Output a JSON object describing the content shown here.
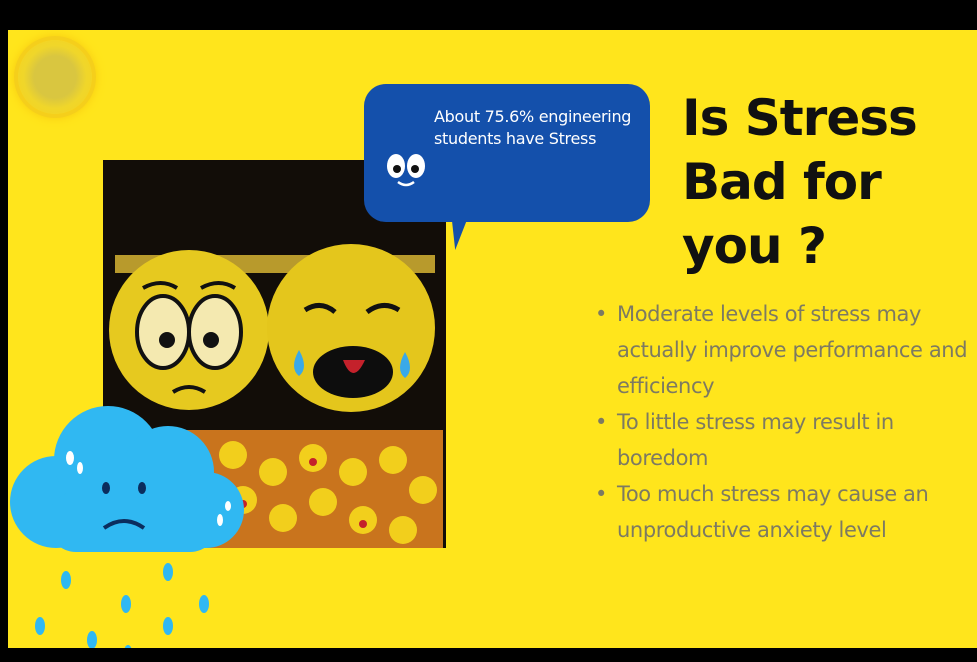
{
  "slide": {
    "bubble_text": "About 75.6% engineering students have Stress",
    "title": "Is Stress Bad for you ?",
    "bullets": [
      "Moderate levels of stress may actually improve performance and efficiency",
      "To little stress may result in boredom",
      "Too much stress may cause an unproductive anxiety level"
    ]
  },
  "colors": {
    "background": "#FFE51C",
    "bubble": "#1450AB",
    "title": "#111111",
    "bullet_text": "#7D7A62",
    "cloud": "#30B8F2"
  },
  "icons": [
    "sun-icon",
    "emoji-photo",
    "speech-bubble-eyes-icon",
    "sad-cloud-icon",
    "raindrops-icon"
  ]
}
